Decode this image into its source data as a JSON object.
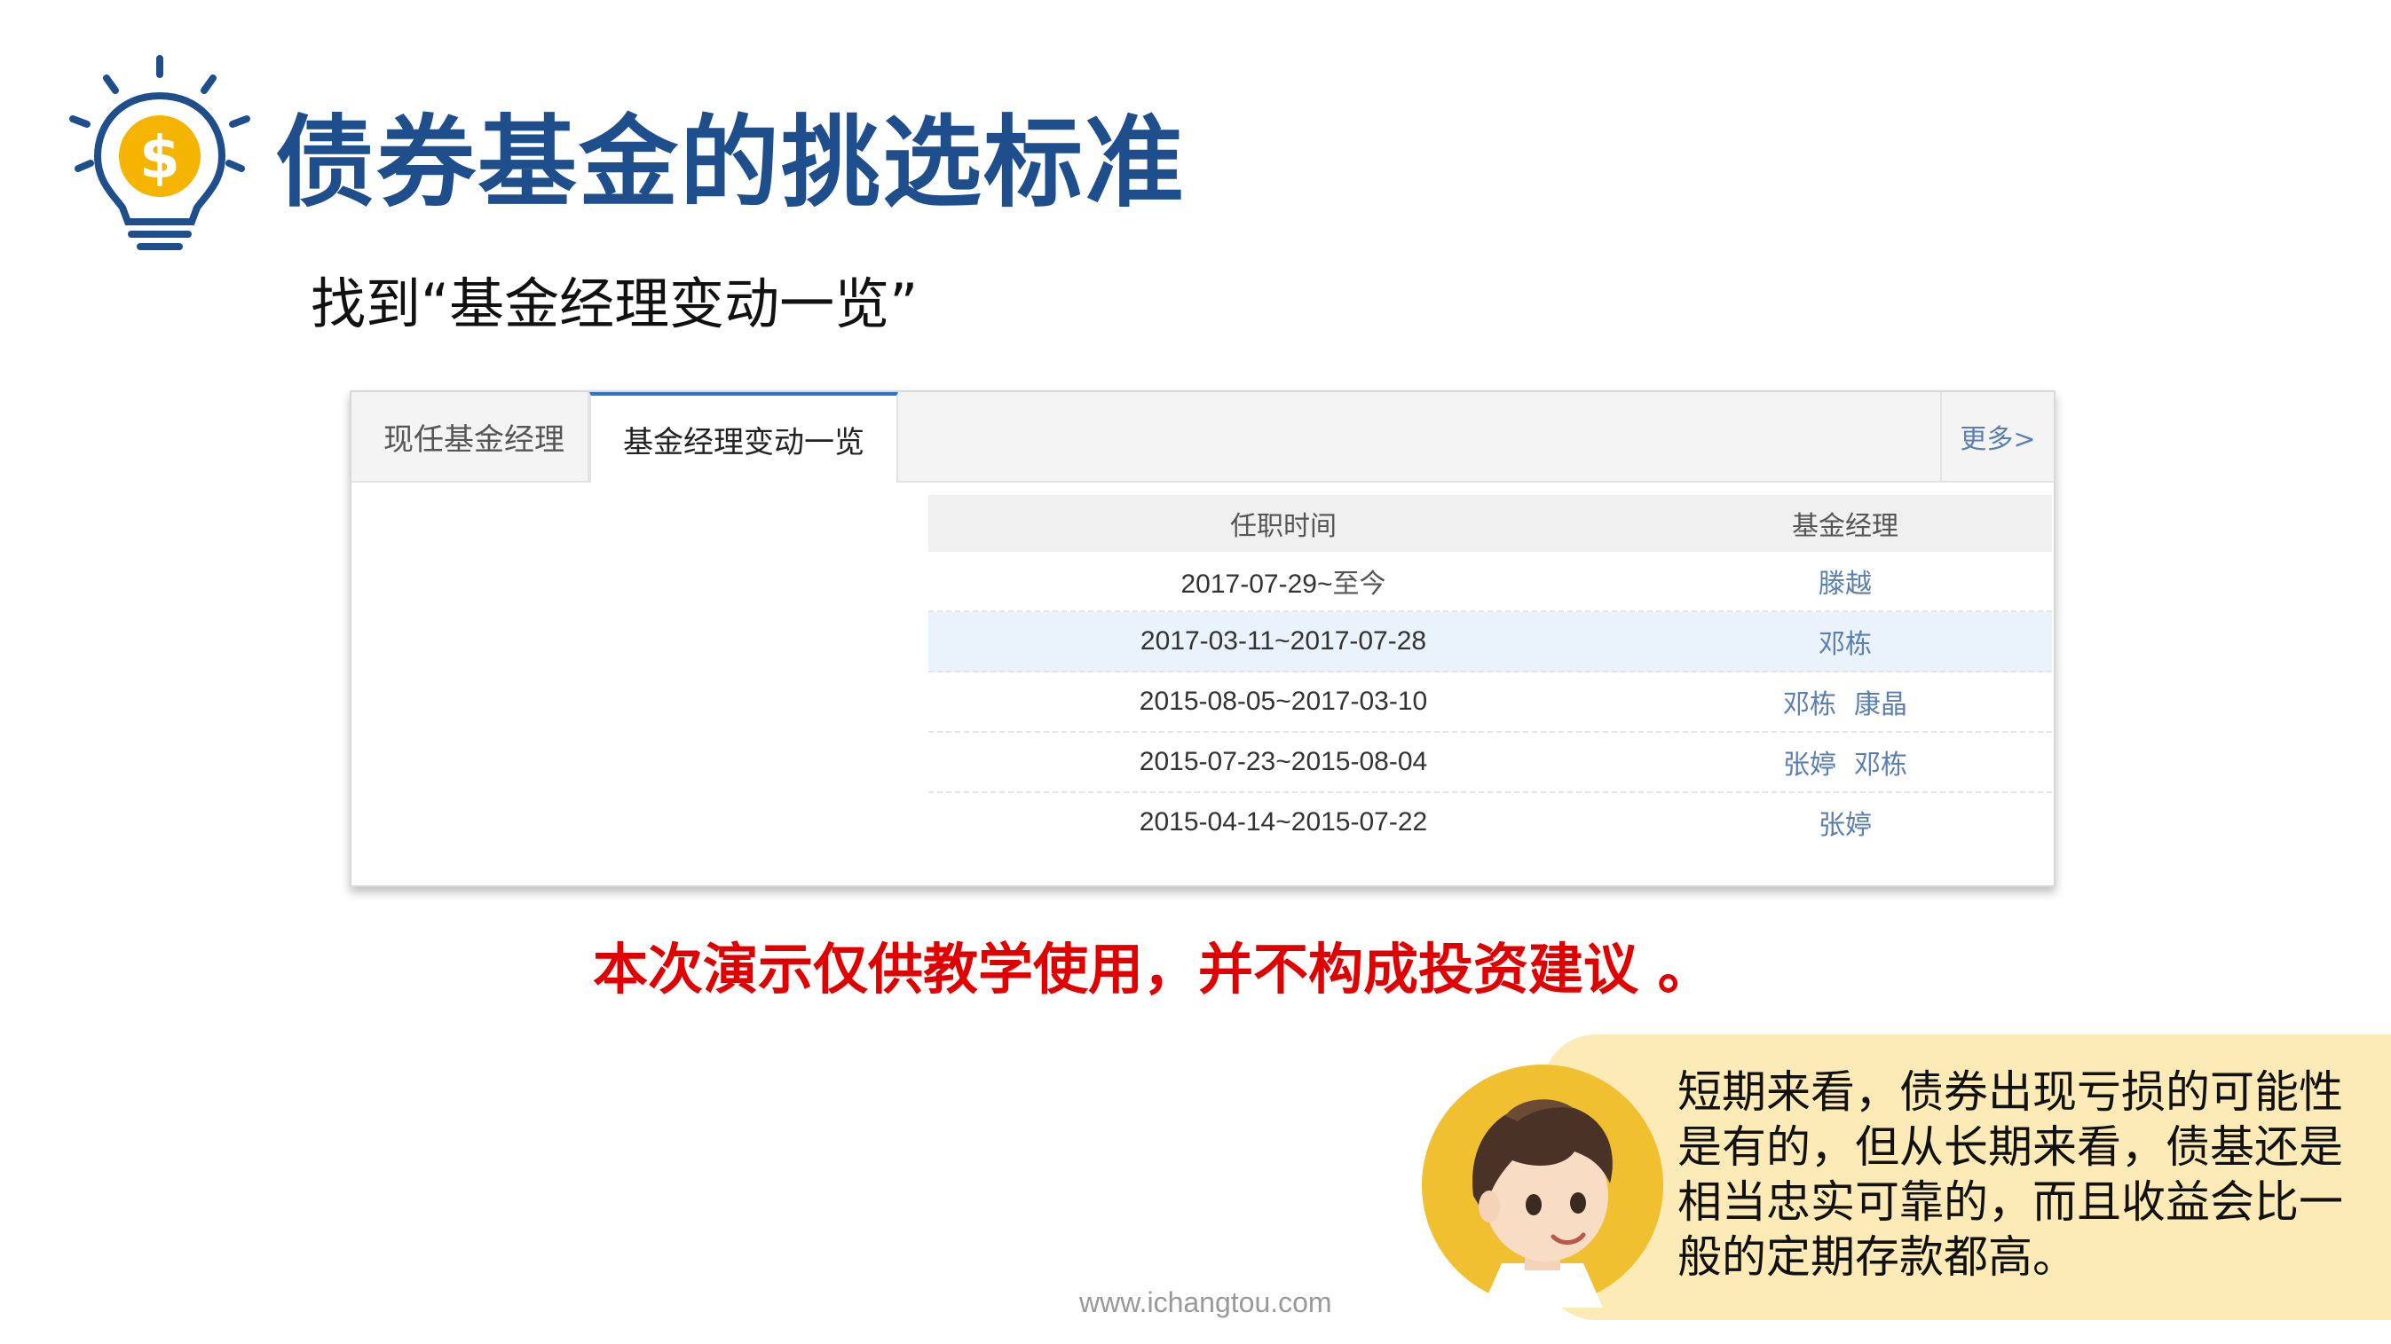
{
  "header": {
    "title": "债券基金的挑选标准",
    "subtitle": "找到“基金经理变动一览”"
  },
  "panel": {
    "tabs": [
      {
        "label": "现任基金经理"
      },
      {
        "label": "基金经理变动一览"
      }
    ],
    "more_label": "更多>",
    "table": {
      "headers": {
        "period": "任职时间",
        "manager": "基金经理"
      },
      "rows": [
        {
          "date_range": "2017-07-29~",
          "date_suffix": "至今",
          "managers": [
            "滕越"
          ]
        },
        {
          "date_range": "2017-03-11~2017-07-28",
          "date_suffix": "",
          "managers": [
            "邓栋"
          ]
        },
        {
          "date_range": "2015-08-05~2017-03-10",
          "date_suffix": "",
          "managers": [
            "邓栋",
            "康晶"
          ]
        },
        {
          "date_range": "2015-07-23~2015-08-04",
          "date_suffix": "",
          "managers": [
            "张婷",
            "邓栋"
          ]
        },
        {
          "date_range": "2015-04-14~2015-07-22",
          "date_suffix": "",
          "managers": [
            "张婷"
          ]
        }
      ]
    }
  },
  "disclaimer": "本次演示仅供教学使用，并不构成投资建议 。",
  "bubble": {
    "text": "短期来看，债券出现亏损的可能性是有的，但从长期来看，债基还是相当忠实可靠的，而且收益会比一般的定期存款都高。"
  },
  "footer": {
    "website": "www.ichangtou.com"
  },
  "colors": {
    "title": "#1f4e8c",
    "disclaimer": "#e00000",
    "accent_tab": "#2d75c8",
    "bubble_bg": "#fcebb6",
    "coin": "#f5b400"
  }
}
